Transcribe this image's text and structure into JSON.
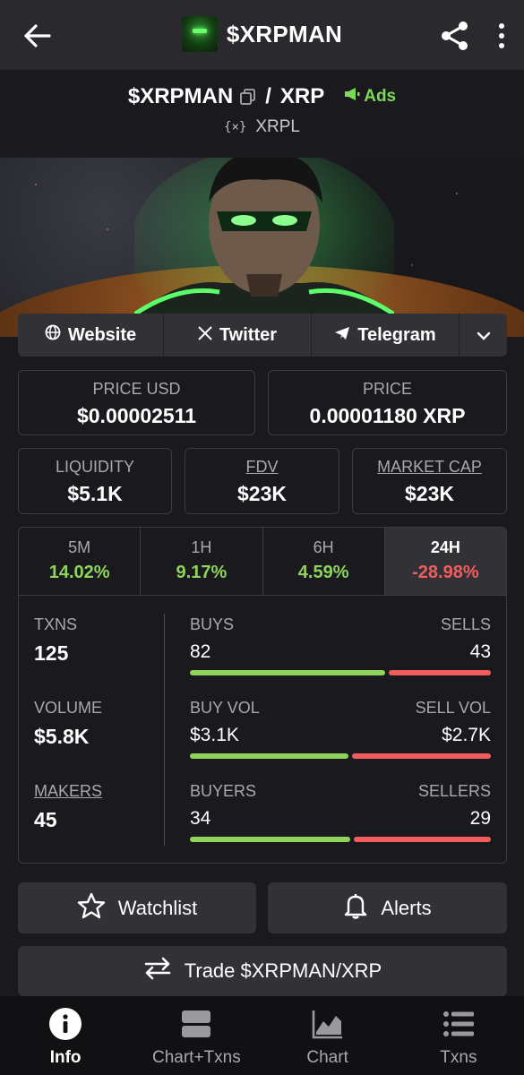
{
  "appbar": {
    "title": "$XRPMAN",
    "icons": [
      "back-arrow-icon",
      "share-icon",
      "more-vert-icon"
    ]
  },
  "pair": {
    "base": "$XRPMAN",
    "slash": "/",
    "quote": "XRP",
    "ads_label": "Ads",
    "chain_icon": "{×}",
    "chain": "XRPL"
  },
  "links": {
    "website": "Website",
    "twitter": "Twitter",
    "telegram": "Telegram"
  },
  "prices": {
    "price_usd_label": "PRICE USD",
    "price_usd": "$0.00002511",
    "price_label": "PRICE",
    "price": "0.00001180 XRP",
    "liquidity_label": "LIQUIDITY",
    "liquidity": "$5.1K",
    "fdv_label": "FDV",
    "fdv": "$23K",
    "mcap_label": "MARKET CAP",
    "mcap": "$23K"
  },
  "timeframes": [
    {
      "label": "5M",
      "value": "14.02%",
      "trend": "up"
    },
    {
      "label": "1H",
      "value": "9.17%",
      "trend": "up"
    },
    {
      "label": "6H",
      "value": "4.59%",
      "trend": "up"
    },
    {
      "label": "24H",
      "value": "-28.98%",
      "trend": "down",
      "active": true
    }
  ],
  "stats": {
    "txns_label": "TXNS",
    "txns": "125",
    "volume_label": "VOLUME",
    "volume": "$5.8K",
    "makers_label": "MAKERS",
    "makers": "45",
    "buys_label": "BUYS",
    "sells_label": "SELLS",
    "buys": "82",
    "sells": "43",
    "buys_fraction": 0.656,
    "buy_vol_label": "BUY VOL",
    "sell_vol_label": "SELL VOL",
    "buy_vol": "$3.1K",
    "sell_vol": "$2.7K",
    "buy_vol_fraction": 0.534,
    "buyers_label": "BUYERS",
    "sellers_label": "SELLERS",
    "buyers": "34",
    "sellers": "29",
    "buyers_fraction": 0.54
  },
  "buttons": {
    "watchlist": "Watchlist",
    "alerts": "Alerts",
    "trade": "Trade $XRPMAN/XRP"
  },
  "nav": [
    {
      "label": "Info",
      "icon": "info-icon",
      "active": true
    },
    {
      "label": "Chart+Txns",
      "icon": "chart-txns-icon"
    },
    {
      "label": "Chart",
      "icon": "chart-icon"
    },
    {
      "label": "Txns",
      "icon": "list-icon"
    }
  ],
  "colors": {
    "positive": "#8fd45a",
    "negative": "#f25c5c",
    "ads": "#7ed957"
  }
}
